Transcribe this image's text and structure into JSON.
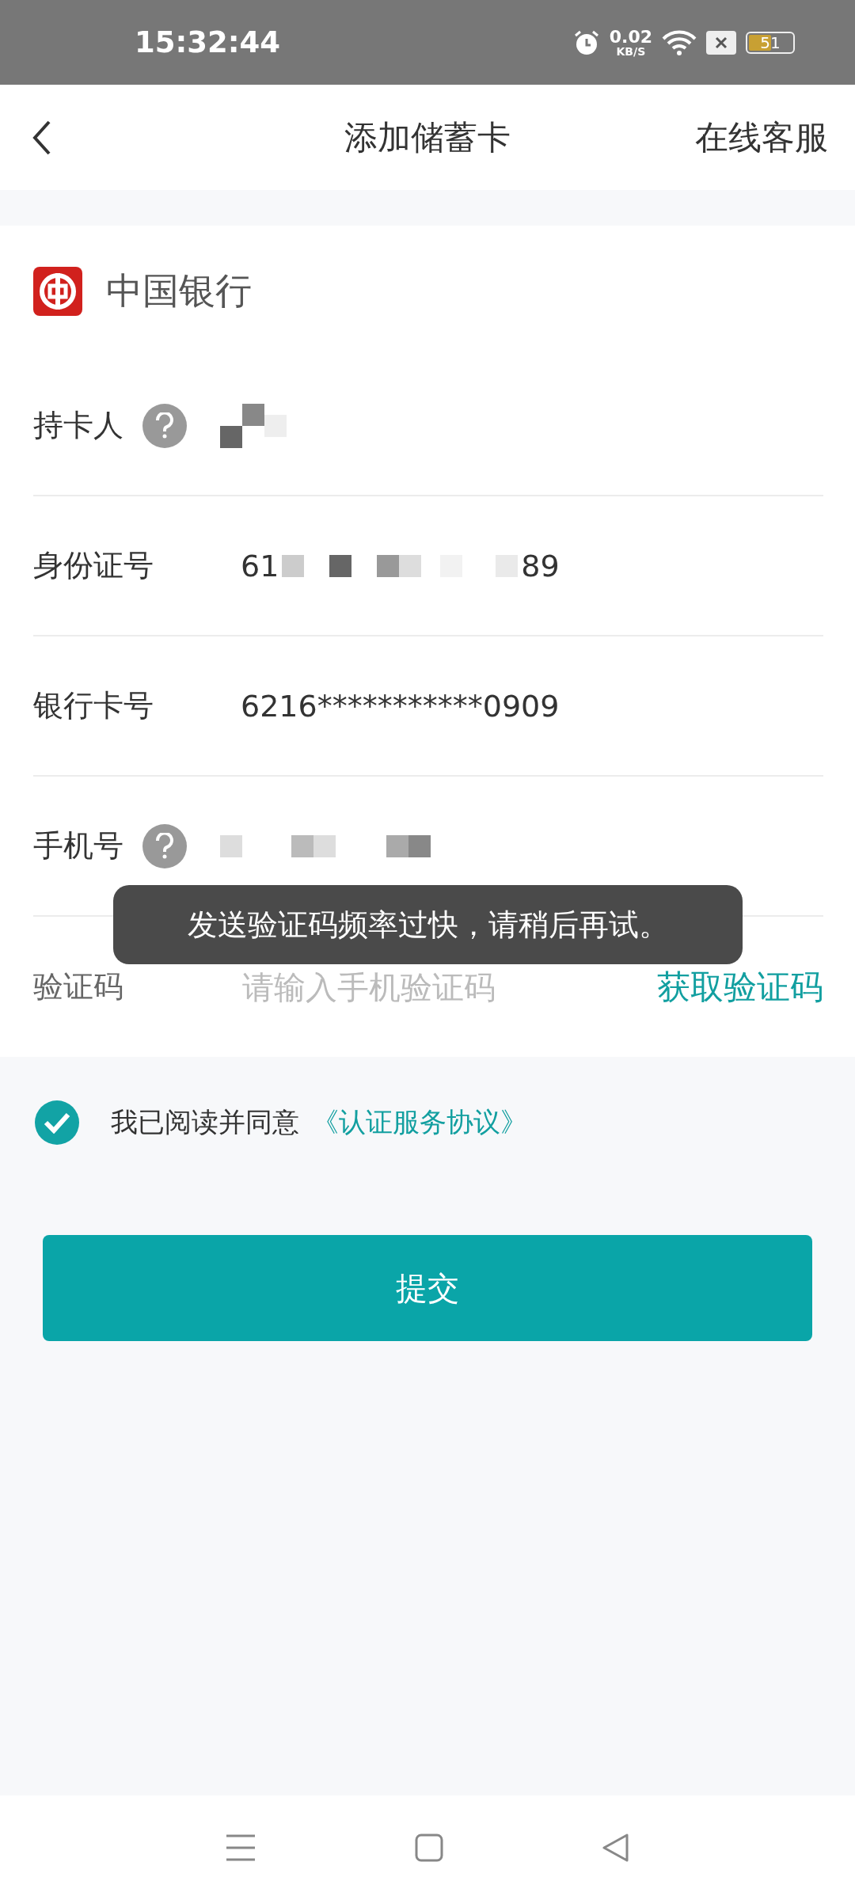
{
  "status_bar": {
    "time": "15:32:44",
    "net_speed": "0.02",
    "net_unit": "KB/S",
    "battery": "51"
  },
  "header": {
    "title": "添加储蓄卡",
    "action": "在线客服"
  },
  "bank": {
    "name": "中国银行"
  },
  "fields": [
    {
      "kind": "masked",
      "label": "持卡人",
      "help": true
    },
    {
      "kind": "masked",
      "label": "身份证号",
      "help": false,
      "prefix": "61",
      "suffix": "89"
    },
    {
      "kind": "text",
      "label": "银行卡号",
      "help": false,
      "value": "6216***********0909"
    },
    {
      "kind": "masked",
      "label": "手机号",
      "help": true
    },
    {
      "kind": "code",
      "label": "验证码",
      "help": false,
      "placeholder": "请输入手机验证码",
      "action": "获取验证码"
    }
  ],
  "agreement": {
    "checked": true,
    "text": "我已阅读并同意",
    "link": "《认证服务协议》"
  },
  "submit": {
    "label": "提交"
  },
  "toast": {
    "message": "发送验证码频率过快，请稍后再试。"
  }
}
